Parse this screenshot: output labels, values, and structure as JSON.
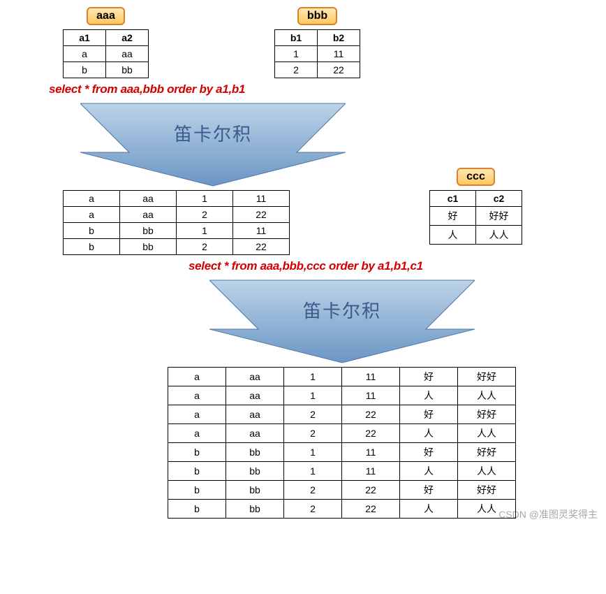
{
  "badges": {
    "aaa": "aaa",
    "bbb": "bbb",
    "ccc": "ccc"
  },
  "tableA": {
    "headers": [
      "a1",
      "a2"
    ],
    "rows": [
      [
        "a",
        "aa"
      ],
      [
        "b",
        "bb"
      ]
    ]
  },
  "tableB": {
    "headers": [
      "b1",
      "b2"
    ],
    "rows": [
      [
        "1",
        "11"
      ],
      [
        "2",
        "22"
      ]
    ]
  },
  "tableC": {
    "headers": [
      "c1",
      "c2"
    ],
    "rows": [
      [
        "好",
        "好好"
      ],
      [
        "人",
        "人人"
      ]
    ]
  },
  "sql1": "select * from aaa,bbb order by a1,b1",
  "arrowLabel": "笛卡尔积",
  "result1": [
    [
      "a",
      "aa",
      "1",
      "11"
    ],
    [
      "a",
      "aa",
      "2",
      "22"
    ],
    [
      "b",
      "bb",
      "1",
      "11"
    ],
    [
      "b",
      "bb",
      "2",
      "22"
    ]
  ],
  "sql2": "select * from aaa,bbb,ccc order by a1,b1,c1",
  "result2": [
    [
      "a",
      "aa",
      "1",
      "11",
      "好",
      "好好"
    ],
    [
      "a",
      "aa",
      "1",
      "11",
      "人",
      "人人"
    ],
    [
      "a",
      "aa",
      "2",
      "22",
      "好",
      "好好"
    ],
    [
      "a",
      "aa",
      "2",
      "22",
      "人",
      "人人"
    ],
    [
      "b",
      "bb",
      "1",
      "11",
      "好",
      "好好"
    ],
    [
      "b",
      "bb",
      "1",
      "11",
      "人",
      "人人"
    ],
    [
      "b",
      "bb",
      "2",
      "22",
      "好",
      "好好"
    ],
    [
      "b",
      "bb",
      "2",
      "22",
      "人",
      "人人"
    ]
  ],
  "watermark": "CSDN @准图灵奖得主",
  "chart_data": {
    "type": "table",
    "title": "Cartesian product (笛卡尔积) of tables aaa, bbb, ccc",
    "tables": {
      "aaa": {
        "columns": [
          "a1",
          "a2"
        ],
        "rows": [
          [
            "a",
            "aa"
          ],
          [
            "b",
            "bb"
          ]
        ]
      },
      "bbb": {
        "columns": [
          "b1",
          "b2"
        ],
        "rows": [
          [
            1,
            11
          ],
          [
            2,
            22
          ]
        ]
      },
      "ccc": {
        "columns": [
          "c1",
          "c2"
        ],
        "rows": [
          [
            "好",
            "好好"
          ],
          [
            "人",
            "人人"
          ]
        ]
      }
    },
    "operations": [
      {
        "sql": "select * from aaa,bbb order by a1,b1",
        "result_rows": 4,
        "result_cols": 4
      },
      {
        "sql": "select * from aaa,bbb,ccc order by a1,b1,c1",
        "result_rows": 8,
        "result_cols": 6
      }
    ]
  }
}
